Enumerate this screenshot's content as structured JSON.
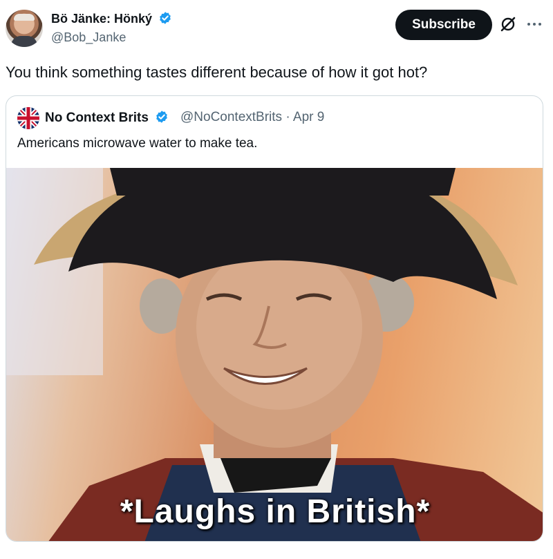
{
  "author": {
    "name": "Bö Jänke: Hönký",
    "handle": "@Bob_Janke",
    "verified": true
  },
  "header": {
    "subscribe_label": "Subscribe",
    "grok_icon": "grok-icon",
    "more_icon": "more-icon"
  },
  "tweet": {
    "text": "You think something tastes different because of how it got hot?"
  },
  "quoted": {
    "name": "No Context Brits",
    "verified": true,
    "handle": "@NoContextBrits",
    "separator": "·",
    "date": "Apr 9",
    "text": "Americans microwave water to make tea.",
    "media_caption": "*Laughs in British*"
  },
  "colors": {
    "verified_blue": "#1d9bf0",
    "text_primary": "#0f1419",
    "text_secondary": "#536471",
    "subscribe_bg": "#0f1419",
    "border": "#cfd9de"
  }
}
